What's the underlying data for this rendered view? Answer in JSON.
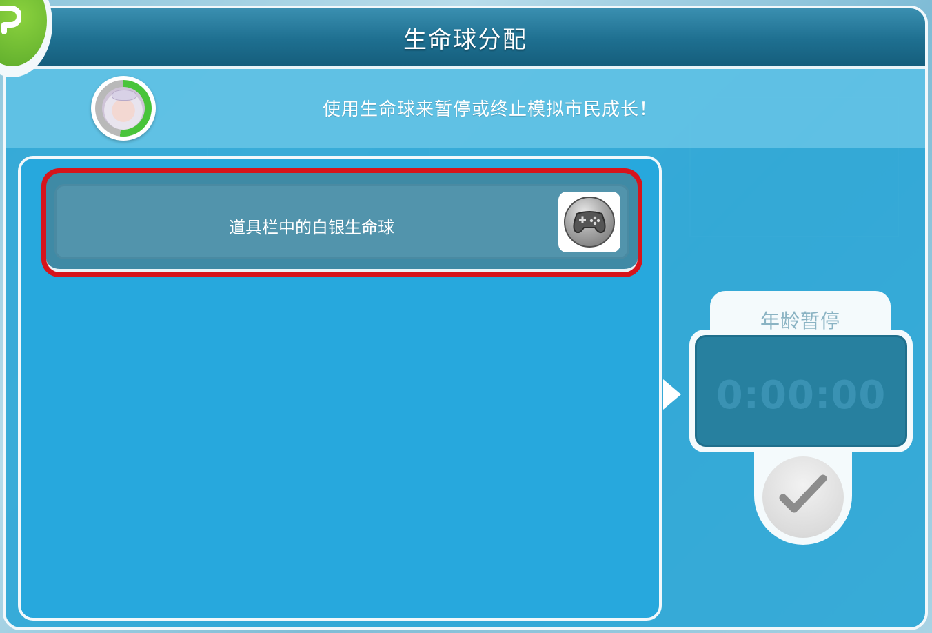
{
  "header": {
    "title": "生命球分配"
  },
  "info": {
    "message": "使用生命球来暂停或终止模拟市民成长！",
    "age_progress": 0.52
  },
  "list": {
    "items": [
      {
        "label": "道具栏中的白银生命球",
        "icon": "silver-lifeball-controller-icon",
        "selected": true
      }
    ]
  },
  "timer": {
    "label": "年龄暂停",
    "value": "0:00:00"
  },
  "colors": {
    "selection_outline": "#d6141b",
    "panel_blue": "#27a8dd",
    "header_blue": "#1e6f90",
    "progress_green": "#49c43a",
    "back_green": "#6cbb34"
  }
}
